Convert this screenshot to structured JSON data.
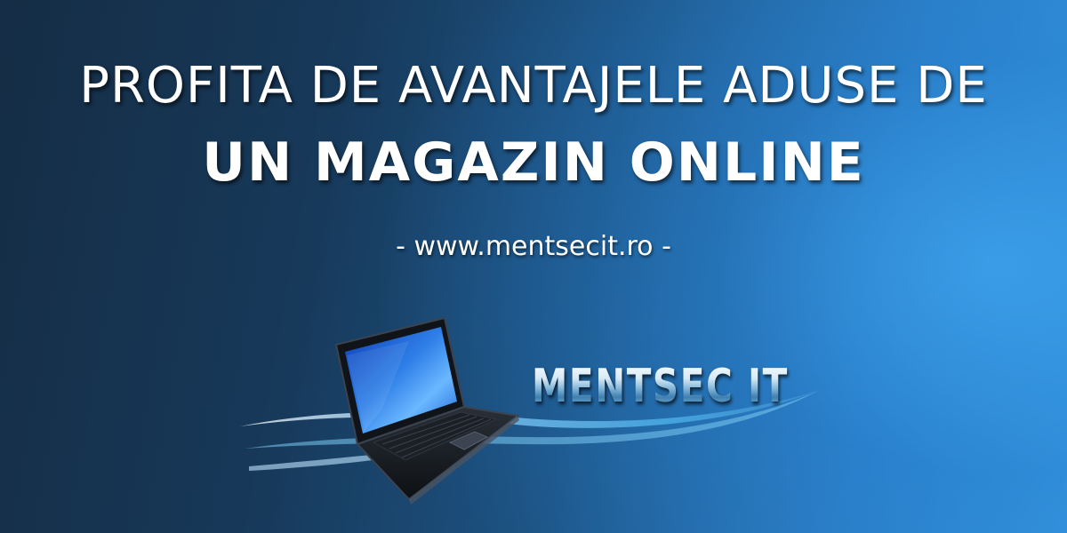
{
  "headline": {
    "line1": "PROFITA DE AVANTAJELE ADUSE DE",
    "line2": "UN MAGAZIN ONLINE"
  },
  "website": "- www.mentsecit.ro -",
  "logo": {
    "brand_text": "MENTSEC IT",
    "icon": "laptop-icon"
  },
  "colors": {
    "background_dark": "#152d45",
    "background_light": "#3596df",
    "text": "#ffffff",
    "swoosh": "#6ec3f0"
  }
}
